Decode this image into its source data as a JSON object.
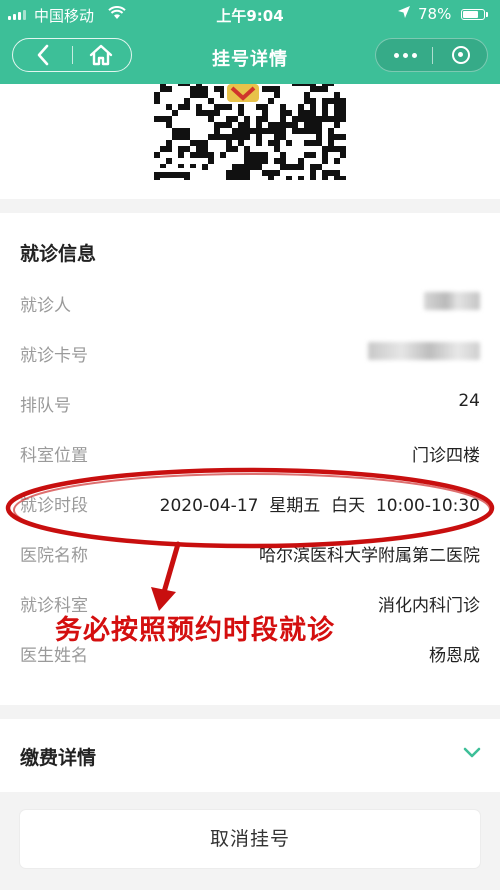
{
  "status_bar": {
    "carrier": "中国移动",
    "time": "上午9:04",
    "battery": "78%",
    "battery_level": 0.78
  },
  "nav": {
    "title": "挂号详情",
    "back_icon": "back-arrow-icon",
    "home_icon": "home-icon",
    "more_icon": "more-dots-icon",
    "close_icon": "miniprogram-close-icon"
  },
  "info": {
    "header": "就诊信息",
    "rows": [
      {
        "label": "就诊人",
        "value": ""
      },
      {
        "label": "就诊卡号",
        "value": ""
      },
      {
        "label": "排队号",
        "value": "24"
      },
      {
        "label": "科室位置",
        "value": "门诊四楼"
      },
      {
        "label": "就诊时段",
        "value": "2020-04-17  星期五  白天  10:00-10:30"
      },
      {
        "label": "医院名称",
        "value": "哈尔滨医科大学附属第二医院"
      },
      {
        "label": "就诊科室",
        "value": "消化内科门诊"
      },
      {
        "label": "医生姓名",
        "value": "杨恩成"
      }
    ]
  },
  "annotation": {
    "text": "务必按照预约时段就诊",
    "color": "#d40f0f"
  },
  "fee": {
    "title": "缴费详情",
    "chevron_icon": "chevron-down-icon"
  },
  "cancel_button": {
    "label": "取消挂号"
  },
  "colors": {
    "brand": "#3dbf98",
    "annotation": "#d40f0f"
  }
}
